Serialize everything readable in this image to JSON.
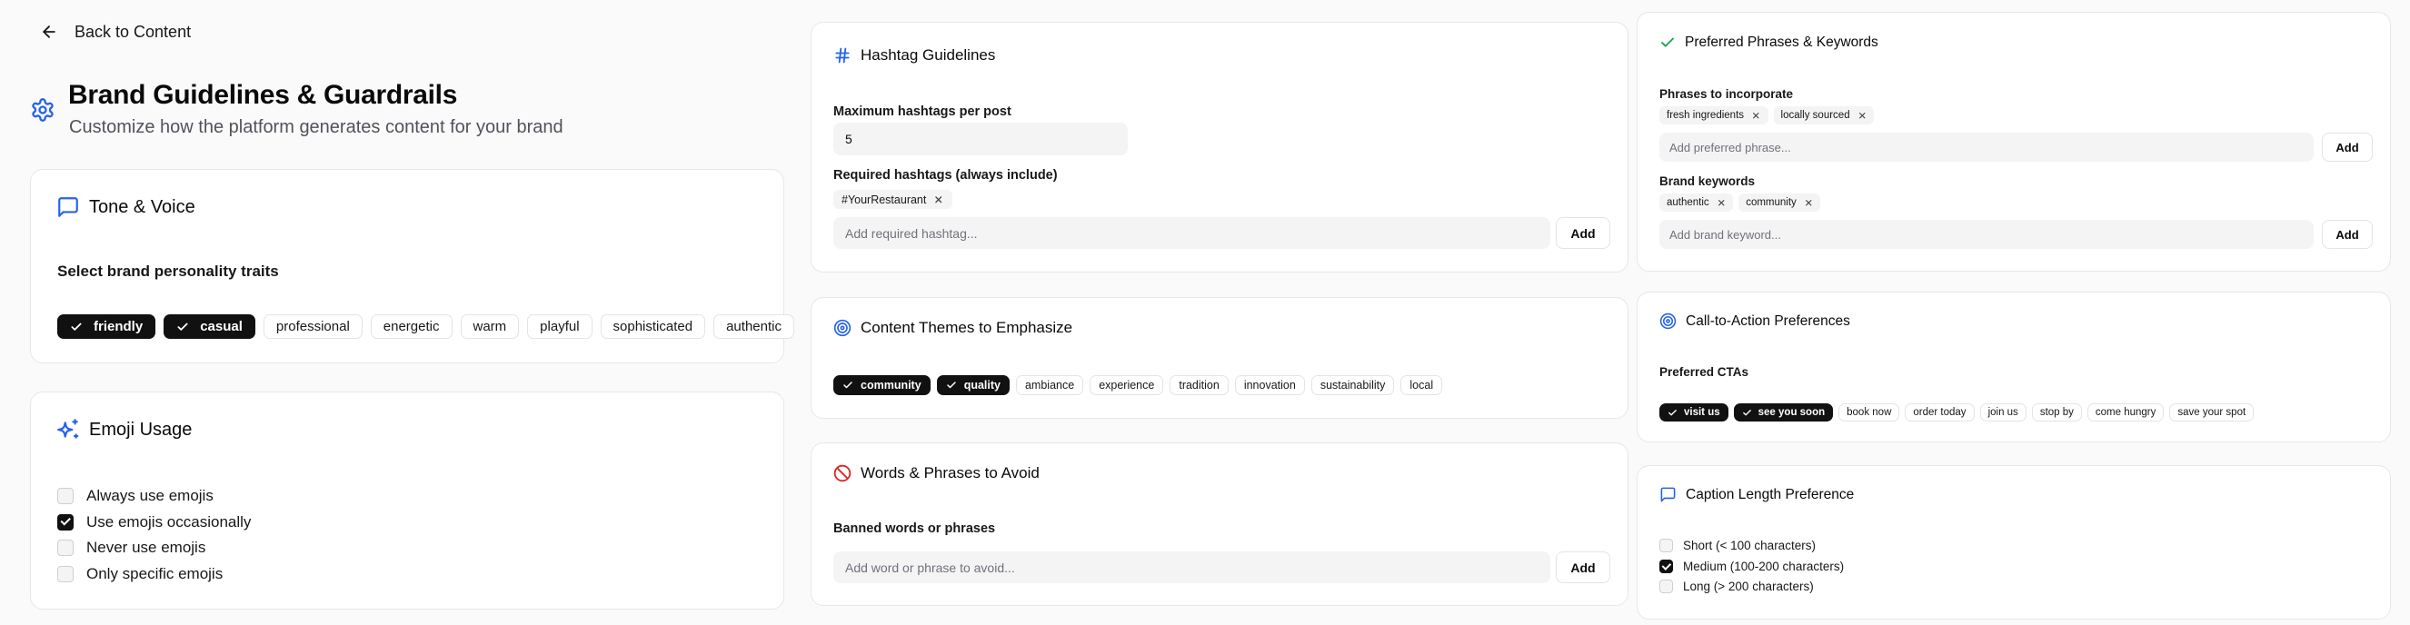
{
  "nav": {
    "back_label": "Back to Content"
  },
  "page": {
    "title": "Brand Guidelines & Guardrails",
    "subtitle": "Customize how the platform generates content for your brand"
  },
  "tone": {
    "title": "Tone & Voice",
    "label": "Select brand personality traits",
    "traits": [
      {
        "label": "friendly",
        "selected": true
      },
      {
        "label": "casual",
        "selected": true
      },
      {
        "label": "professional",
        "selected": false
      },
      {
        "label": "energetic",
        "selected": false
      },
      {
        "label": "warm",
        "selected": false
      },
      {
        "label": "playful",
        "selected": false
      },
      {
        "label": "sophisticated",
        "selected": false
      },
      {
        "label": "authentic",
        "selected": false
      }
    ]
  },
  "emoji": {
    "title": "Emoji Usage",
    "options": [
      {
        "label": "Always use emojis",
        "checked": false
      },
      {
        "label": "Use emojis occasionally",
        "checked": true
      },
      {
        "label": "Never use emojis",
        "checked": false
      },
      {
        "label": "Only specific emojis",
        "checked": false
      }
    ]
  },
  "hashtags": {
    "title": "Hashtag Guidelines",
    "max_label": "Maximum hashtags per post",
    "max_value": "5",
    "required_label": "Required hashtags (always include)",
    "required": [
      "#YourRestaurant"
    ],
    "input_placeholder": "Add required hashtag...",
    "add_label": "Add"
  },
  "themes": {
    "title": "Content Themes to Emphasize",
    "items": [
      {
        "label": "community",
        "selected": true
      },
      {
        "label": "quality",
        "selected": true
      },
      {
        "label": "ambiance",
        "selected": false
      },
      {
        "label": "experience",
        "selected": false
      },
      {
        "label": "tradition",
        "selected": false
      },
      {
        "label": "innovation",
        "selected": false
      },
      {
        "label": "sustainability",
        "selected": false
      },
      {
        "label": "local",
        "selected": false
      }
    ]
  },
  "avoid": {
    "title": "Words & Phrases to Avoid",
    "label": "Banned words or phrases",
    "input_placeholder": "Add word or phrase to avoid...",
    "add_label": "Add"
  },
  "phrases": {
    "title": "Preferred Phrases & Keywords",
    "phrases_label": "Phrases to incorporate",
    "phrases": [
      "fresh ingredients",
      "locally sourced"
    ],
    "phrase_placeholder": "Add preferred phrase...",
    "keywords_label": "Brand keywords",
    "keywords": [
      "authentic",
      "community"
    ],
    "keyword_placeholder": "Add brand keyword...",
    "add_label": "Add"
  },
  "cta": {
    "title": "Call-to-Action Preferences",
    "label": "Preferred CTAs",
    "items": [
      {
        "label": "visit us",
        "selected": true
      },
      {
        "label": "see you soon",
        "selected": true
      },
      {
        "label": "book now",
        "selected": false
      },
      {
        "label": "order today",
        "selected": false
      },
      {
        "label": "join us",
        "selected": false
      },
      {
        "label": "stop by",
        "selected": false
      },
      {
        "label": "come hungry",
        "selected": false
      },
      {
        "label": "save your spot",
        "selected": false
      }
    ]
  },
  "caption": {
    "title": "Caption Length Preference",
    "options": [
      {
        "label": "Short (< 100 characters)",
        "checked": false
      },
      {
        "label": "Medium (100-200 characters)",
        "checked": true
      },
      {
        "label": "Long (> 200 characters)",
        "checked": false
      }
    ]
  },
  "colors": {
    "accent": "#2563eb",
    "danger": "#dc2626",
    "success": "#16a34a",
    "selected_bg": "#111111"
  }
}
